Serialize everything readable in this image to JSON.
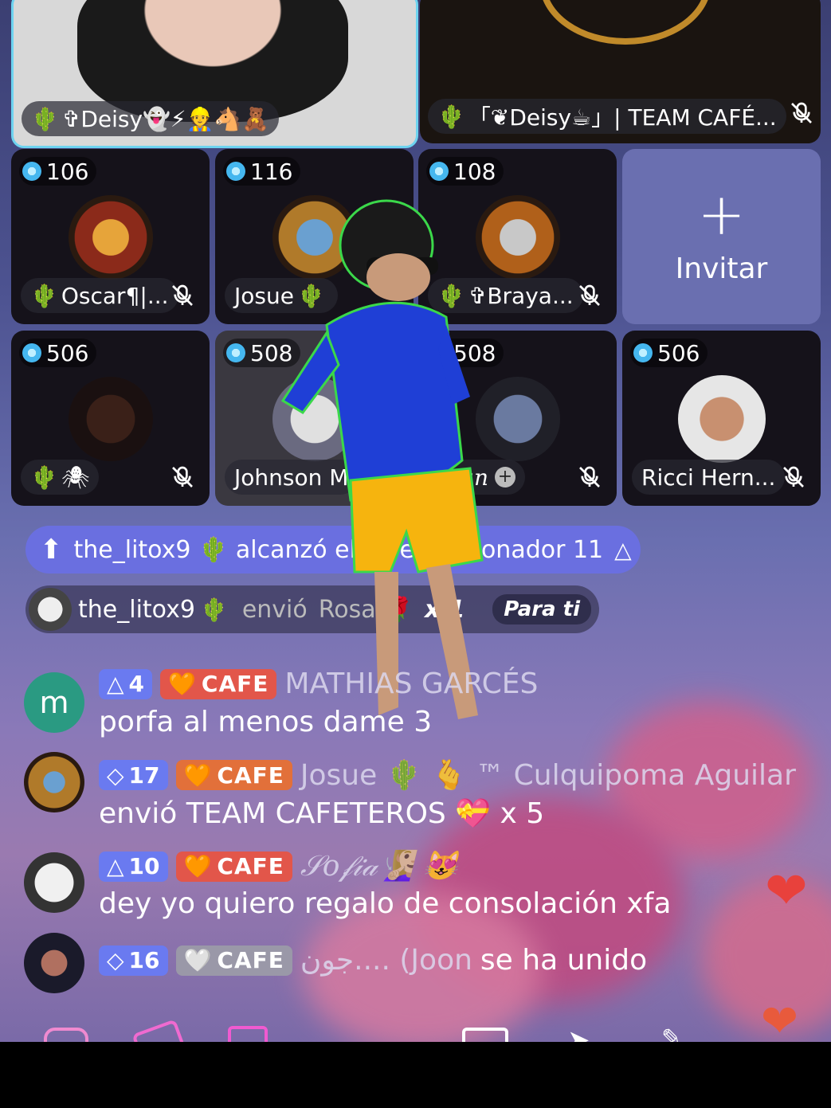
{
  "top_tiles": {
    "host_name": "✞Deisy👻⚡👷🐴🧸",
    "guest_name": "「❦Deisy☕」| TEAM CAFÉ..."
  },
  "seats": [
    {
      "score": "106",
      "name": "Oscar¶|...",
      "muted": true
    },
    {
      "score": "116",
      "name": "Josue",
      "muted": false
    },
    {
      "score": "108",
      "name": "✞Braya...",
      "muted": true
    },
    {
      "score": "506",
      "name": "🕷",
      "muted": true
    },
    {
      "score": "508",
      "name": "Johnson M",
      "muted": false
    },
    {
      "score": "508",
      "name": "Juan",
      "muted": true
    },
    {
      "score": "506",
      "name": "Ricci Hern...",
      "muted": true
    }
  ],
  "invite": {
    "label": "Invitar",
    "plus": "+"
  },
  "banner": {
    "text": "the_litox9 🌵 alcanzó el nivel de donador 11"
  },
  "gift_notice": {
    "user": "the_litox9",
    "action": "envió",
    "gift": "Rosa",
    "count": "x 1",
    "target": "Para ti"
  },
  "chat": [
    {
      "level": "4",
      "club": "CAFE",
      "user": "MATHIAS GARCÉS",
      "avatar_letter": "m",
      "message": "porfa al menos dame 3"
    },
    {
      "level": "17",
      "club": "CAFE",
      "user": "Josue 🌵 🫰 ™ Culquipoma Aguilar",
      "message": "envió TEAM CAFETEROS 💝 x 5"
    },
    {
      "level": "10",
      "club": "CAFE",
      "user": "𝒮𝑜𝒻𝒾𝒶🧏🏼‍♀️ 😻",
      "message": "dey yo quiero regalo de consolación xfa"
    },
    {
      "level": "16",
      "club": "CAFE",
      "user": "جون.... (Joon",
      "message": "se ha unido"
    }
  ],
  "colors": {
    "accent": "#6a6fe0",
    "cactus": "#46b94a",
    "club": "#e2564a",
    "heart": "#e8413c"
  }
}
